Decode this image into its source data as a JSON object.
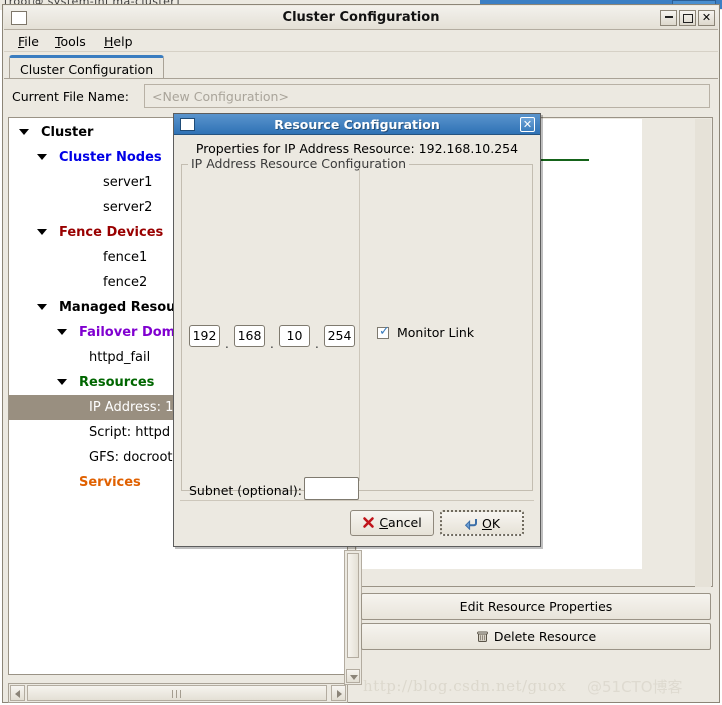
{
  "desktop": {
    "ghost_text": "[root@ system-ini ma-cluster]"
  },
  "window": {
    "title": "Cluster Configuration",
    "icon": "window-icon",
    "controls": {
      "minimize": "−",
      "maximize": "□",
      "close": "✕"
    }
  },
  "menubar": {
    "items": [
      {
        "label": "File",
        "mnemonic": "F"
      },
      {
        "label": "Tools",
        "mnemonic": "T"
      },
      {
        "label": "Help",
        "mnemonic": "H"
      }
    ]
  },
  "tabs": [
    {
      "label": "Cluster Configuration",
      "active": true
    }
  ],
  "file_row": {
    "label": "Current File Name:",
    "value": "",
    "placeholder": "<New Configuration>"
  },
  "tree": {
    "items": [
      {
        "label": "Cluster",
        "indent": 0,
        "expander": true,
        "color": "#000000",
        "bold": true,
        "selected": false
      },
      {
        "label": "Cluster Nodes",
        "indent": 1,
        "expander": true,
        "color": "#0000e6",
        "bold": true,
        "selected": false
      },
      {
        "label": "server1",
        "indent": 2,
        "expander": false,
        "color": "#000000",
        "bold": false,
        "selected": false
      },
      {
        "label": "server2",
        "indent": 2,
        "expander": false,
        "color": "#000000",
        "bold": false,
        "selected": false
      },
      {
        "label": "Fence Devices",
        "indent": 1,
        "expander": true,
        "color": "#990000",
        "bold": true,
        "selected": false
      },
      {
        "label": "fence1",
        "indent": 2,
        "expander": false,
        "color": "#000000",
        "bold": false,
        "selected": false
      },
      {
        "label": "fence2",
        "indent": 2,
        "expander": false,
        "color": "#000000",
        "bold": false,
        "selected": false
      },
      {
        "label": "Managed Resour",
        "indent": 1,
        "expander": true,
        "color": "#000000",
        "bold": true,
        "selected": false
      },
      {
        "label": "Failover Doma",
        "indent": 2,
        "expander": true,
        "color": "#8000d0",
        "bold": true,
        "selected": false
      },
      {
        "label": "httpd_fail",
        "indent": 3,
        "expander": false,
        "color": "#000000",
        "bold": false,
        "selected": false
      },
      {
        "label": "Resources",
        "indent": 2,
        "expander": true,
        "color": "#006600",
        "bold": true,
        "selected": false
      },
      {
        "label": "IP Address:  1",
        "indent": 3,
        "expander": false,
        "color": "#ffffff",
        "bold": false,
        "selected": true
      },
      {
        "label": "Script:  httpd",
        "indent": 3,
        "expander": false,
        "color": "#000000",
        "bold": false,
        "selected": false
      },
      {
        "label": "GFS:  docroot",
        "indent": 3,
        "expander": false,
        "color": "#000000",
        "bold": false,
        "selected": false
      },
      {
        "label": "Services",
        "indent": 2,
        "expander": false,
        "color": "#e06000",
        "bold": true,
        "selected": false
      }
    ]
  },
  "right_actions": {
    "edit_label": "Edit Resource Properties",
    "delete_label": "Delete Resource",
    "delete_icon": "trash-icon"
  },
  "dialog": {
    "title": "Resource Configuration",
    "icon": "dialog-icon",
    "close_glyph": "✕",
    "properties_line": "Properties for IP Address Resource: 192.168.10.254",
    "group_legend": "IP Address Resource Configuration",
    "ip_octets": [
      "192",
      "168",
      "10",
      "254"
    ],
    "ip_separator": ".",
    "monitor_link": {
      "label": "Monitor Link",
      "checked": true,
      "check_glyph": "✓"
    },
    "subnet": {
      "label": "Subnet (optional):",
      "value": ""
    },
    "buttons": {
      "cancel": {
        "label": "Cancel",
        "mnemonic": "C",
        "icon": "cancel-x-icon"
      },
      "ok": {
        "label": "OK",
        "mnemonic": "O",
        "icon": "enter-arrow-icon",
        "focused": true
      }
    }
  },
  "watermark": {
    "url": "http://blog.csdn.net/guox",
    "overlay": "@51CTO博客"
  },
  "colors": {
    "titlebar_dialog": "#3b7cbc",
    "selection": "#998f80",
    "tab_accent": "#3a7dc0",
    "panel_bg": "#ece9e1",
    "green_rule": "#15631a"
  }
}
